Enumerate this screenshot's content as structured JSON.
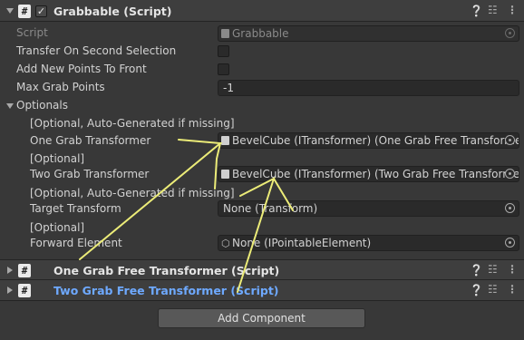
{
  "header": {
    "title": "Grabbable (Script)",
    "enabled": true
  },
  "fields": {
    "script": {
      "label": "Script",
      "value": "Grabbable"
    },
    "transfer_second": {
      "label": "Transfer On Second Selection"
    },
    "add_new_points": {
      "label": "Add New Points To Front"
    },
    "max_grab_points": {
      "label": "Max Grab Points",
      "value": "-1"
    }
  },
  "optionals": {
    "label": "Optionals",
    "one_grab_hint": "[Optional, Auto-Generated if missing]",
    "one_grab_label": "One Grab Transformer",
    "one_grab_value": "BevelCube (ITransformer) (One Grab Free Transformer)",
    "two_grab_hint": "[Optional]",
    "two_grab_label": "Two Grab Transformer",
    "two_grab_value": "BevelCube (ITransformer) (Two Grab Free Transformer)",
    "target_hint": "[Optional, Auto-Generated if missing]",
    "target_label": "Target Transform",
    "target_value": "None (Transform)",
    "forward_hint": "[Optional]",
    "forward_label": "Forward Element",
    "forward_value": "None (IPointableElement)"
  },
  "components": [
    {
      "title": "One Grab Free Transformer (Script)",
      "highlight": false
    },
    {
      "title": "Two Grab Free Transformer (Script)",
      "highlight": true,
      "highlight_color": "#6ea9ff"
    }
  ],
  "add_component_label": "Add Component",
  "annotation_color": "#ecec78"
}
